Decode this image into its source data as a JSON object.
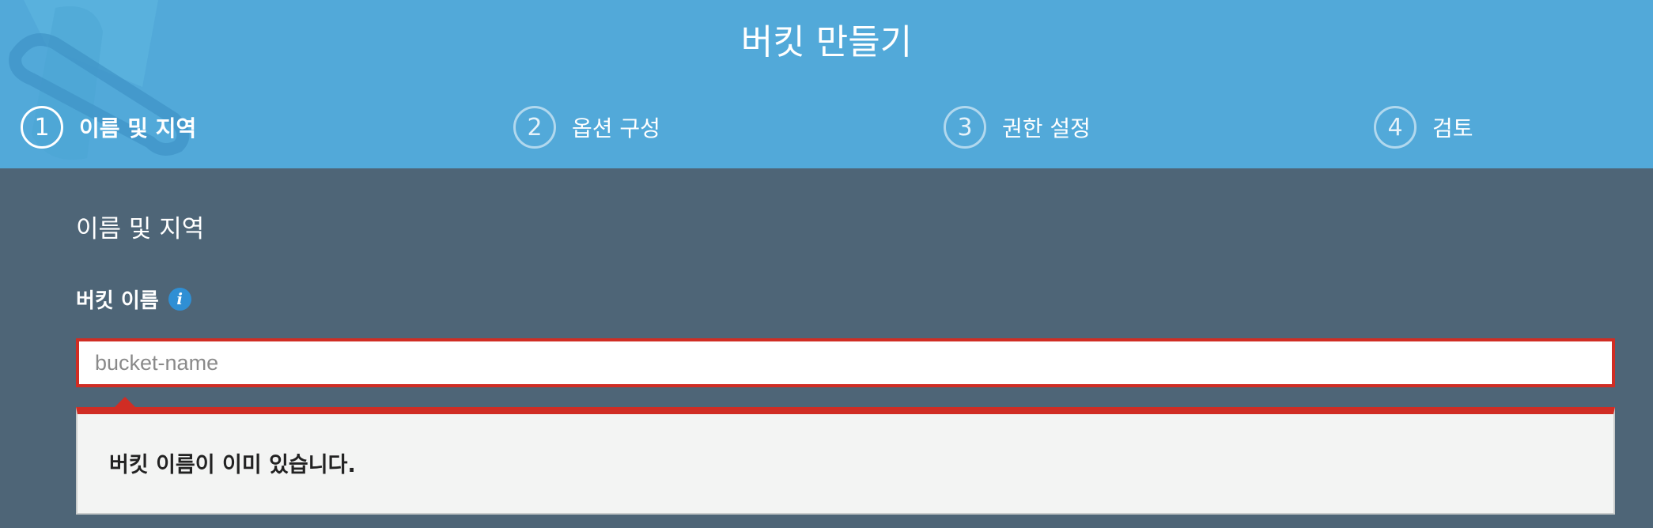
{
  "modal": {
    "title": "버킷 만들기",
    "steps": [
      {
        "number": "1",
        "label": "이름 및 지역",
        "active": true
      },
      {
        "number": "2",
        "label": "옵션 구성",
        "active": false
      },
      {
        "number": "3",
        "label": "권한 설정",
        "active": false
      },
      {
        "number": "4",
        "label": "검토",
        "active": false
      }
    ]
  },
  "form": {
    "section_title": "이름 및 지역",
    "bucket_name_label": "버킷 이름",
    "info_icon": "info-icon",
    "bucket_name_placeholder": "bucket-name",
    "bucket_name_value": "",
    "error_message": "버킷 이름이 이미 있습니다."
  },
  "colors": {
    "header_bg": "#52a9d9",
    "body_bg": "#4e6577",
    "error_red": "#d02d24",
    "info_blue": "#2f8fd4"
  }
}
